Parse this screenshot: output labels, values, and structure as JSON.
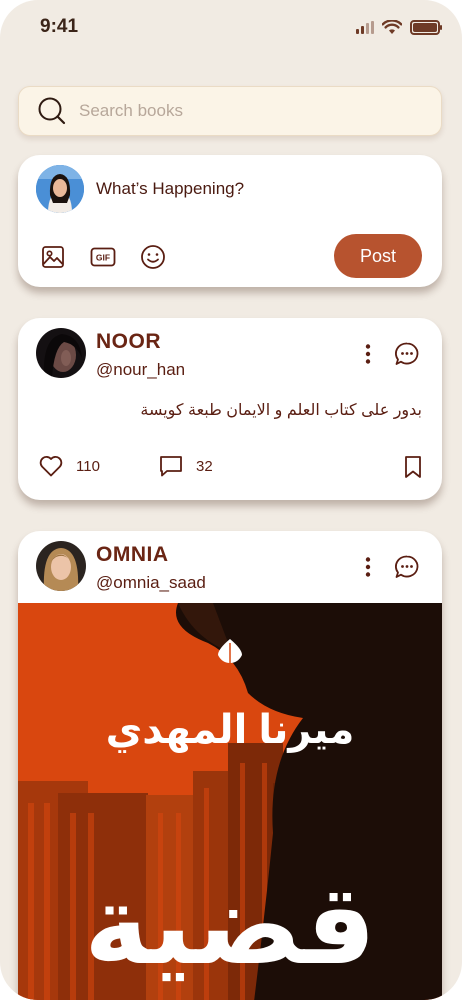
{
  "status_bar": {
    "time": "9:41"
  },
  "search": {
    "placeholder": "Search books"
  },
  "composer": {
    "prompt": "What’s Happening?",
    "post_label": "Post",
    "tools": [
      "image-icon",
      "gif-icon",
      "emoji-icon"
    ]
  },
  "posts": [
    {
      "name": "NOOR",
      "handle": "@nour_han",
      "text": "بدور على كتاب العلم و الايمان طبعة كويسة",
      "likes": "110",
      "comments": "32"
    },
    {
      "name": "OMNIA",
      "handle": "@omnia_saad",
      "cover": {
        "author": "ميرنا المهدي",
        "title": "قضية"
      }
    }
  ],
  "colors": {
    "background": "#f1ebe3",
    "accent": "#b7532f",
    "text": "#5a1e12",
    "cover": "#d9470f"
  }
}
